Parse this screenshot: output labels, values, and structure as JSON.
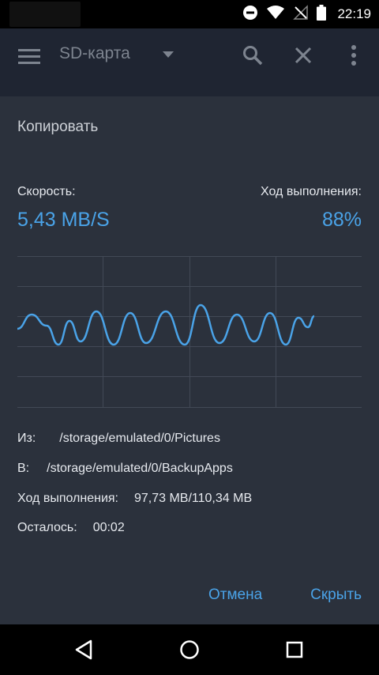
{
  "status_bar": {
    "time": "22:19",
    "icons": [
      "do-not-disturb-icon",
      "wifi-icon",
      "no-signal-icon",
      "battery-icon"
    ]
  },
  "toolbar": {
    "title": "SD-карта",
    "icons": [
      "menu-icon",
      "dropdown-arrow-icon",
      "search-icon",
      "close-icon",
      "more-vert-icon"
    ]
  },
  "dialog": {
    "title": "Копировать",
    "speed_label": "Скорость:",
    "speed_value": "5,43 MB/S",
    "progress_label": "Ход выполнения:",
    "progress_value": "88%",
    "details": [
      {
        "label": "Из:",
        "value": "/storage/emulated/0/Pictures"
      },
      {
        "label": "В:",
        "value": "/storage/emulated/0/BackupApps"
      },
      {
        "label": "Ход выполнения:",
        "value": "97,73 MB/110,34 MB"
      },
      {
        "label": "Осталось:",
        "value": "00:02"
      }
    ],
    "cancel_label": "Отмена",
    "hide_label": "Скрыть"
  },
  "colors": {
    "accent": "#4aa3e8",
    "dialog_bg": "#2b313c",
    "toolbar_bg": "#1f2532"
  },
  "nav_bar": {
    "icons": [
      "back-icon",
      "home-icon",
      "recents-icon"
    ]
  }
}
